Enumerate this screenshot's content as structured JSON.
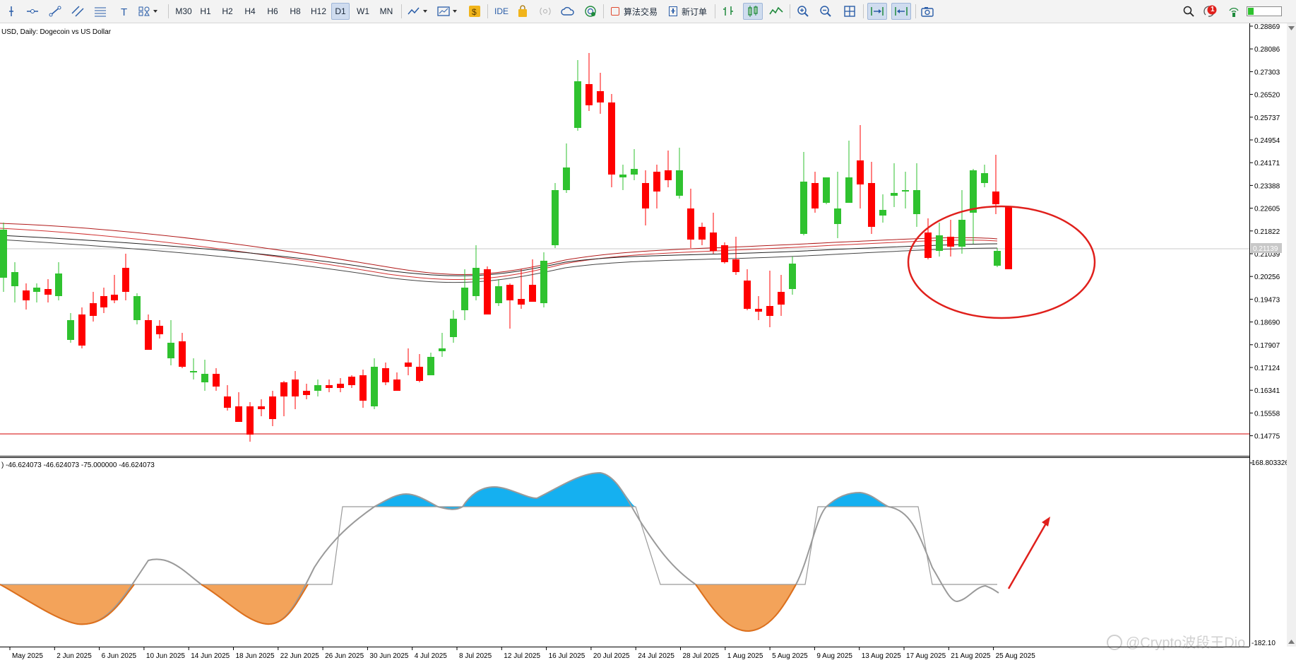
{
  "toolbar": {
    "timeframes": [
      "M30",
      "H1",
      "H2",
      "H4",
      "H6",
      "H8",
      "H12",
      "D1",
      "W1",
      "MN"
    ],
    "active_timeframe": "D1",
    "ide_label": "IDE",
    "algo_trading_label": "算法交易",
    "new_order_label": "新订单",
    "notification_count": "1"
  },
  "chart": {
    "title": "USD, Daily:  Dogecoin vs US Dollar",
    "current_price_label": "0.21139",
    "price_ticks": [
      "0.28869",
      "0.28086",
      "0.27303",
      "0.26520",
      "0.25737",
      "0.24954",
      "0.24171",
      "0.23388",
      "0.22605",
      "0.21822",
      "0.21039",
      "0.20256",
      "0.19473",
      "0.18690",
      "0.17907",
      "0.17124",
      "0.16341",
      "0.15558",
      "0.14775"
    ],
    "date_ticks": [
      "May 2025",
      "2 Jun 2025",
      "6 Jun 2025",
      "10 Jun 2025",
      "14 Jun 2025",
      "18 Jun 2025",
      "22 Jun 2025",
      "26 Jun 2025",
      "30 Jun 2025",
      "4 Jul 2025",
      "8 Jul 2025",
      "12 Jul 2025",
      "16 Jul 2025",
      "20 Jul 2025",
      "24 Jul 2025",
      "28 Jul 2025",
      "1 Aug 2025",
      "5 Aug 2025",
      "9 Aug 2025",
      "13 Aug 2025",
      "17 Aug 2025",
      "21 Aug 2025",
      "25 Aug 2025"
    ]
  },
  "indicator": {
    "label": ") -46.624073 -46.624073 -75.000000 -46.624073",
    "scale_top": "168.803326",
    "scale_bottom": "-182.10"
  },
  "watermark": "@Crypto波段王Dio",
  "colors": {
    "bull": "#2fc22f",
    "bear": "#ff0000",
    "osc_positive": "#15b0f0",
    "osc_negative": "#f3a35a",
    "annotation": "#e0201c"
  }
}
